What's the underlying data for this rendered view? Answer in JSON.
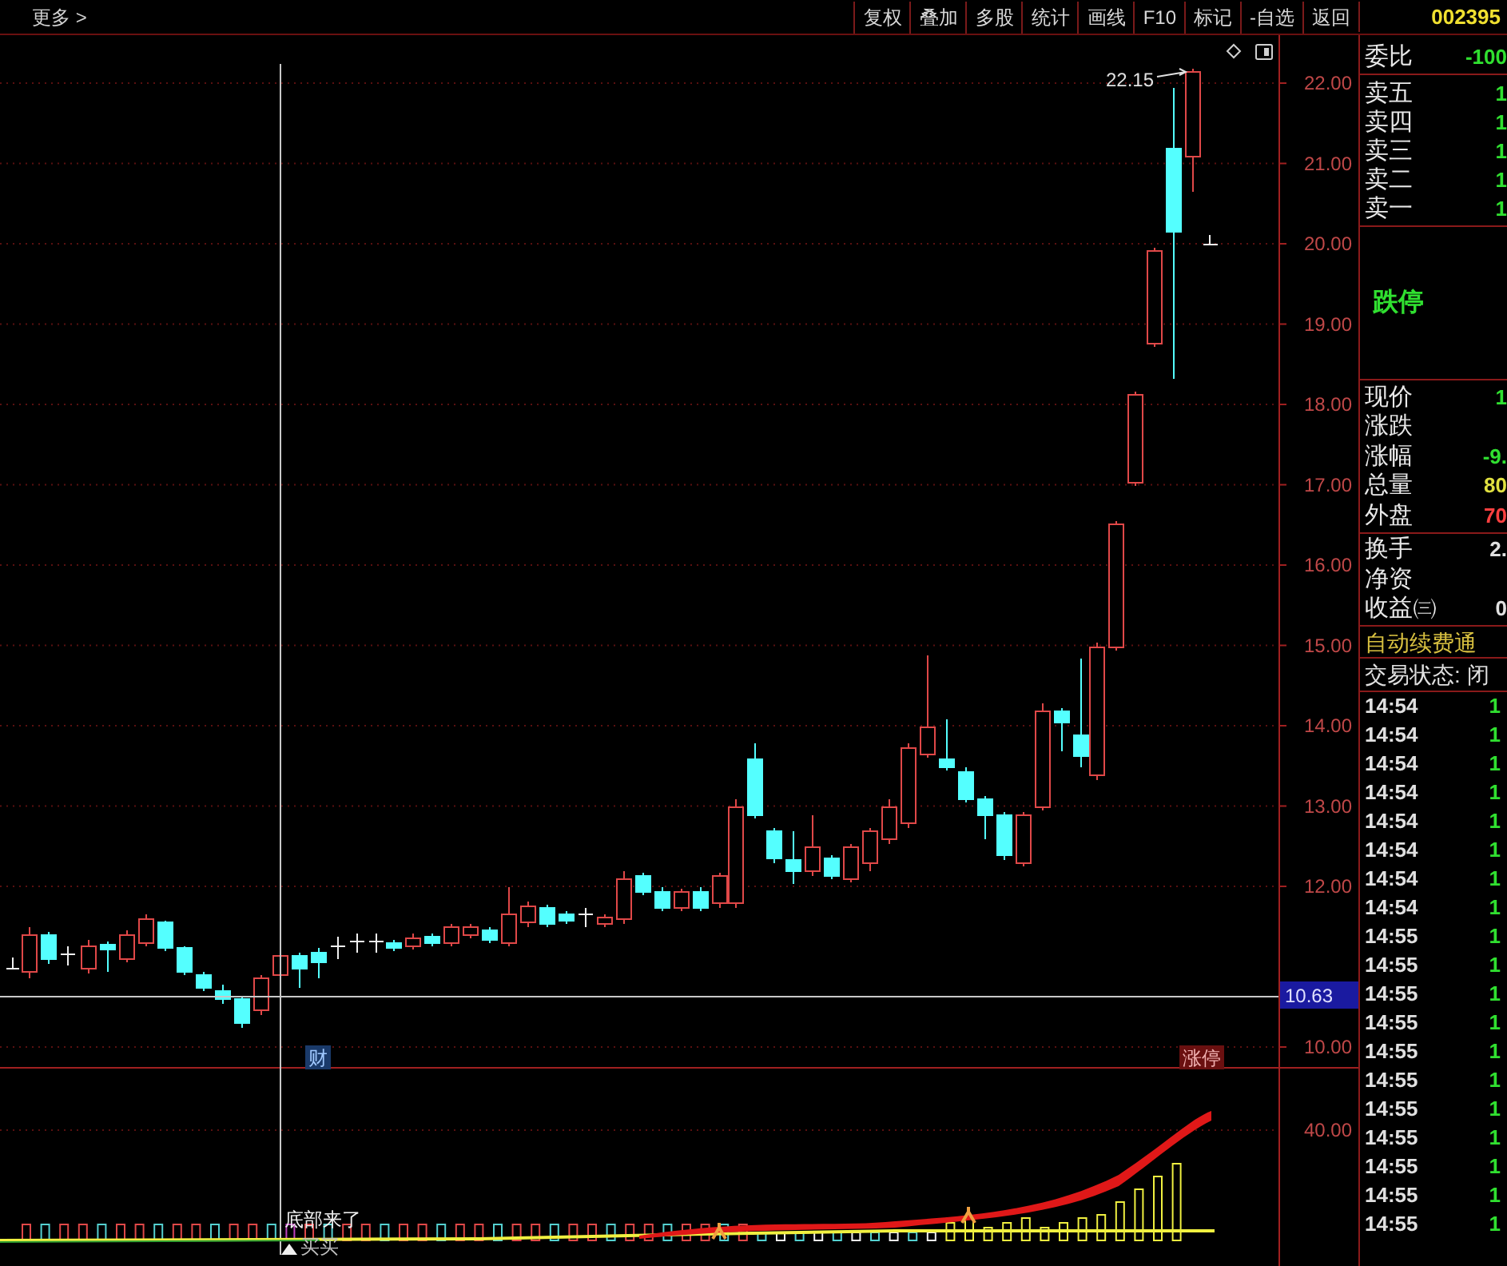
{
  "toolbar": {
    "menu": "更多 >",
    "buttons": [
      {
        "label": "复权"
      },
      {
        "label": "叠加"
      },
      {
        "label": "多股"
      },
      {
        "label": "统计"
      },
      {
        "label": "画线"
      },
      {
        "label": "F10"
      },
      {
        "label": "标记"
      },
      {
        "label": "-自选"
      },
      {
        "label": "返回"
      }
    ],
    "stock_code": "002395"
  },
  "chart": {
    "price_axis": [
      "22.00",
      "21.00",
      "20.00",
      "19.00",
      "18.00",
      "17.00",
      "16.00",
      "15.00",
      "14.00",
      "13.00",
      "12.00",
      "10.00"
    ],
    "crosshair_price": "10.63",
    "high_marker": "22.15",
    "markers": [
      {
        "text": "财",
        "kind": "finance"
      },
      {
        "text": "涨停",
        "kind": "limit"
      }
    ],
    "indicator_axis": "40.00",
    "signals": [
      {
        "text": "底部来了",
        "kind": "note"
      },
      {
        "text": "买买",
        "kind": "buy"
      }
    ]
  },
  "quote": {
    "order_ratio": {
      "label": "委比",
      "value": "-100",
      "color": "#30e030"
    },
    "asks": [
      {
        "label": "卖五",
        "value": "1",
        "color": "#30e030"
      },
      {
        "label": "卖四",
        "value": "1",
        "color": "#30e030"
      },
      {
        "label": "卖三",
        "value": "1",
        "color": "#30e030"
      },
      {
        "label": "卖二",
        "value": "1",
        "color": "#30e030"
      },
      {
        "label": "卖一",
        "value": "1",
        "color": "#30e030"
      }
    ],
    "limit_status": "跌停",
    "stats": [
      {
        "label": "现价",
        "value": "1",
        "color": "#30e030"
      },
      {
        "label": "涨跌"
      },
      {
        "label": "涨幅",
        "value": "-9.",
        "color": "#30e030"
      },
      {
        "label": "总量",
        "value": "80",
        "color": "#e0e040"
      },
      {
        "label": "外盘",
        "value": "70",
        "color": "#ff4040"
      }
    ],
    "extra": [
      {
        "label": "换手",
        "value": "2.",
        "color": "#e0e0e0"
      },
      {
        "label": "净资"
      },
      {
        "label": "收益㈢",
        "value": "0",
        "color": "#e0e0e0"
      }
    ],
    "notice": "自动续费通",
    "trade_status": "交易状态: 闭",
    "trades": [
      {
        "time": "14:54",
        "value": "1"
      },
      {
        "time": "14:54",
        "value": "1"
      },
      {
        "time": "14:54",
        "value": "1"
      },
      {
        "time": "14:54",
        "value": "1"
      },
      {
        "time": "14:54",
        "value": "1"
      },
      {
        "time": "14:54",
        "value": "1"
      },
      {
        "time": "14:54",
        "value": "1"
      },
      {
        "time": "14:54",
        "value": "1"
      },
      {
        "time": "14:55",
        "value": "1"
      },
      {
        "time": "14:55",
        "value": "1"
      },
      {
        "time": "14:55",
        "value": "1"
      },
      {
        "time": "14:55",
        "value": "1"
      },
      {
        "time": "14:55",
        "value": "1"
      },
      {
        "time": "14:55",
        "value": "1"
      },
      {
        "time": "14:55",
        "value": "1"
      },
      {
        "time": "14:55",
        "value": "1"
      },
      {
        "time": "14:55",
        "value": "1"
      },
      {
        "time": "14:55",
        "value": "1"
      },
      {
        "time": "14:55",
        "value": "1"
      }
    ]
  }
}
